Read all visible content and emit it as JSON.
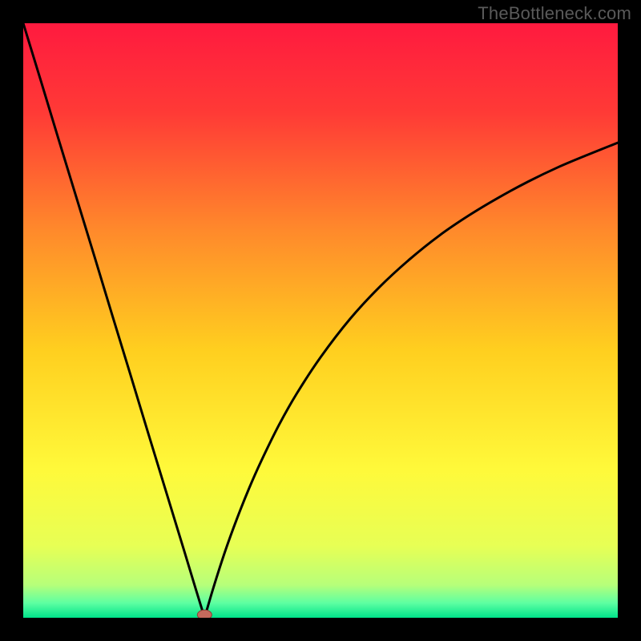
{
  "watermark": "TheBottleneck.com",
  "chart_data": {
    "type": "line",
    "title": "",
    "xlabel": "",
    "ylabel": "",
    "xlim": [
      0,
      100
    ],
    "ylim": [
      0,
      100
    ],
    "optimum_x": 30.5,
    "series": [
      {
        "name": "bottleneck-curve",
        "x": [
          0,
          3,
          6,
          9,
          12,
          15,
          18,
          21,
          24,
          27,
          29,
          30.5,
          32,
          34,
          36,
          38,
          40,
          43,
          46,
          50,
          55,
          60,
          65,
          70,
          75,
          80,
          85,
          90,
          95,
          100
        ],
        "y": [
          100,
          90.2,
          80.3,
          70.5,
          60.7,
          50.8,
          41.0,
          31.1,
          21.3,
          11.5,
          4.9,
          0.0,
          5.1,
          11.3,
          16.8,
          21.8,
          26.3,
          32.4,
          37.7,
          43.8,
          50.3,
          55.7,
          60.3,
          64.3,
          67.7,
          70.7,
          73.4,
          75.8,
          77.9,
          79.9
        ]
      }
    ],
    "marker": {
      "x": 30.5,
      "y": 0.5,
      "color": "#c46a5d"
    },
    "background_gradient": {
      "stops": [
        {
          "offset": 0.0,
          "color": "#ff1a3f"
        },
        {
          "offset": 0.15,
          "color": "#ff3a36"
        },
        {
          "offset": 0.35,
          "color": "#ff8a2b"
        },
        {
          "offset": 0.55,
          "color": "#ffcf1f"
        },
        {
          "offset": 0.75,
          "color": "#fff93a"
        },
        {
          "offset": 0.88,
          "color": "#e7ff55"
        },
        {
          "offset": 0.945,
          "color": "#b6ff7a"
        },
        {
          "offset": 0.975,
          "color": "#5effa2"
        },
        {
          "offset": 1.0,
          "color": "#00e38a"
        }
      ]
    }
  }
}
